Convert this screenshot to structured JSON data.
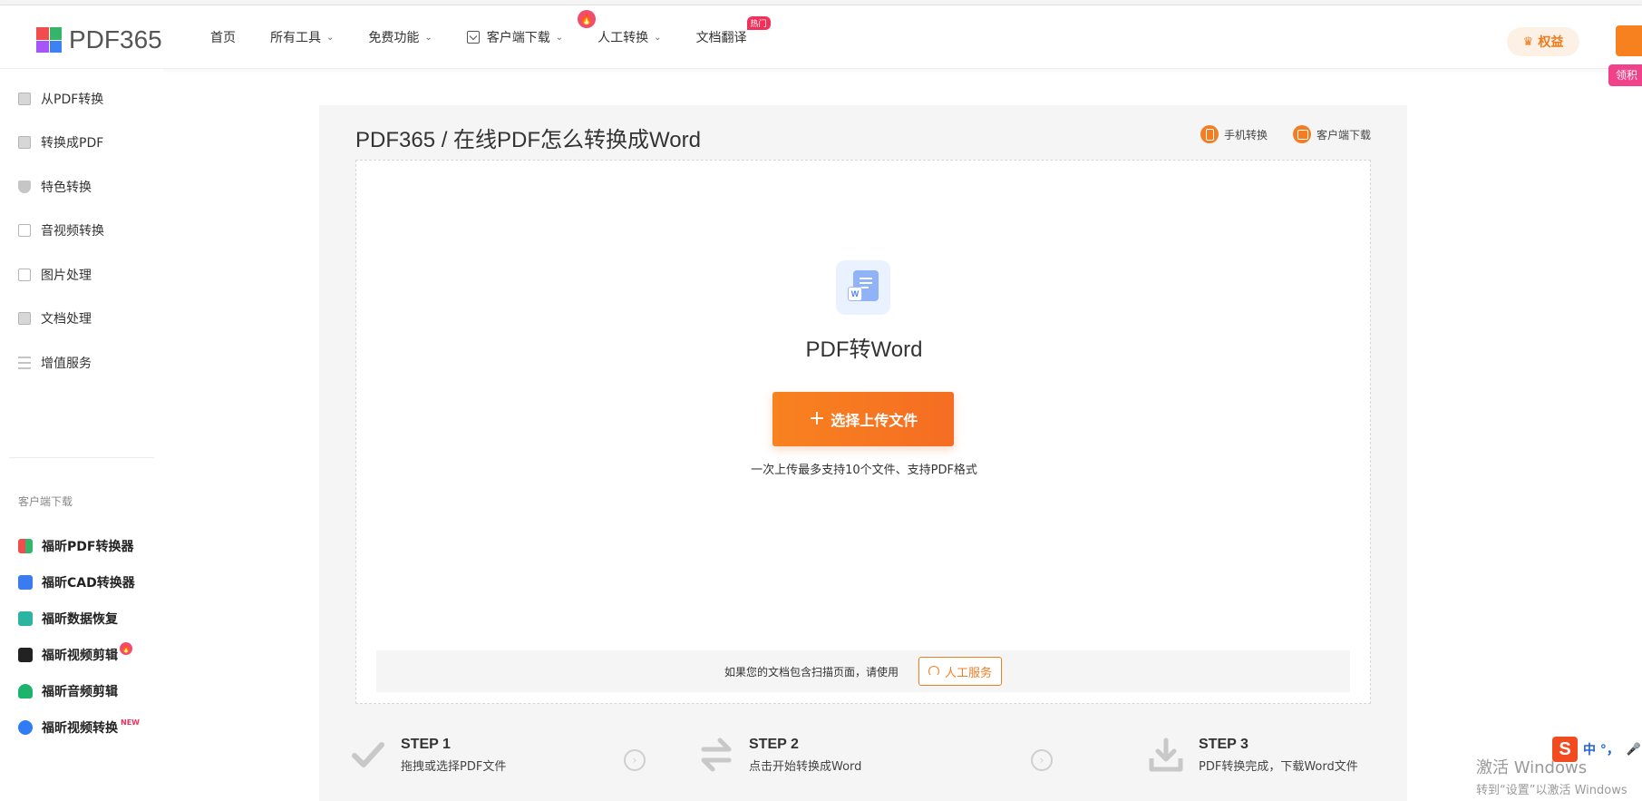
{
  "header": {
    "logo_text": "PDF365",
    "nav": [
      {
        "label": "首页",
        "dropdown": false
      },
      {
        "label": "所有工具",
        "dropdown": true
      },
      {
        "label": "免费功能",
        "dropdown": true
      },
      {
        "label": "客户端下载",
        "dropdown": true
      },
      {
        "label": "人工转换",
        "dropdown": true
      },
      {
        "label": "文档翻译",
        "dropdown": false,
        "badge": "热门"
      }
    ],
    "rights_label": "权益",
    "pink_tag": "领积"
  },
  "sidebar": {
    "categories": [
      {
        "label": "从PDF转换",
        "icon": "file-from-pdf-icon"
      },
      {
        "label": "转换成PDF",
        "icon": "file-to-pdf-icon"
      },
      {
        "label": "特色转换",
        "icon": "shield-icon"
      },
      {
        "label": "音视频转换",
        "icon": "video-file-icon"
      },
      {
        "label": "图片处理",
        "icon": "image-icon"
      },
      {
        "label": "文档处理",
        "icon": "document-icon"
      },
      {
        "label": "增值服务",
        "icon": "list-icon"
      }
    ],
    "client_caption": "客户端下载",
    "clients": [
      {
        "label": "福昕PDF转换器",
        "icon": "pdf-converter-icon",
        "color": "#4f8ef7"
      },
      {
        "label": "福昕CAD转换器",
        "icon": "cad-converter-icon",
        "color": "#3b7bf0"
      },
      {
        "label": "福昕数据恢复",
        "icon": "data-recovery-icon",
        "color": "#2bb5a0"
      },
      {
        "label": "福昕视频剪辑",
        "icon": "video-editor-icon",
        "color": "#222222",
        "badge": "hot"
      },
      {
        "label": "福昕音频剪辑",
        "icon": "audio-editor-icon",
        "color": "#1cb36b"
      },
      {
        "label": "福昕视频转换",
        "icon": "video-converter-icon",
        "color": "#2f7cf6",
        "badge": "NEW"
      }
    ]
  },
  "main": {
    "breadcrumb": "PDF365 / 在线PDF怎么转换成Word",
    "links": {
      "mobile": "手机转换",
      "client": "客户端下载"
    },
    "tool_title": "PDF转Word",
    "upload_button": "选择上传文件",
    "upload_hint": "一次上传最多支持10个文件、支持PDF格式",
    "scan_text": "如果您的文档包含扫描页面，请使用",
    "service_button": "人工服务"
  },
  "steps": [
    {
      "label": "STEP 1",
      "desc": "拖拽或选择PDF文件",
      "icon": "check-icon"
    },
    {
      "label": "STEP 2",
      "desc": "点击开始转换成Word",
      "icon": "convert-arrows-icon"
    },
    {
      "label": "STEP 3",
      "desc": "PDF转换完成，下载Word文件",
      "icon": "download-tray-icon"
    }
  ],
  "overlay": {
    "ime_text": "中 °，",
    "watermark_line1": "激活 Windows",
    "watermark_line2": "转到“设置”以激活 Windows"
  },
  "colors": {
    "accent": "#f7811f",
    "hot": "#f0315a",
    "panel_bg": "#f5f5f5"
  }
}
